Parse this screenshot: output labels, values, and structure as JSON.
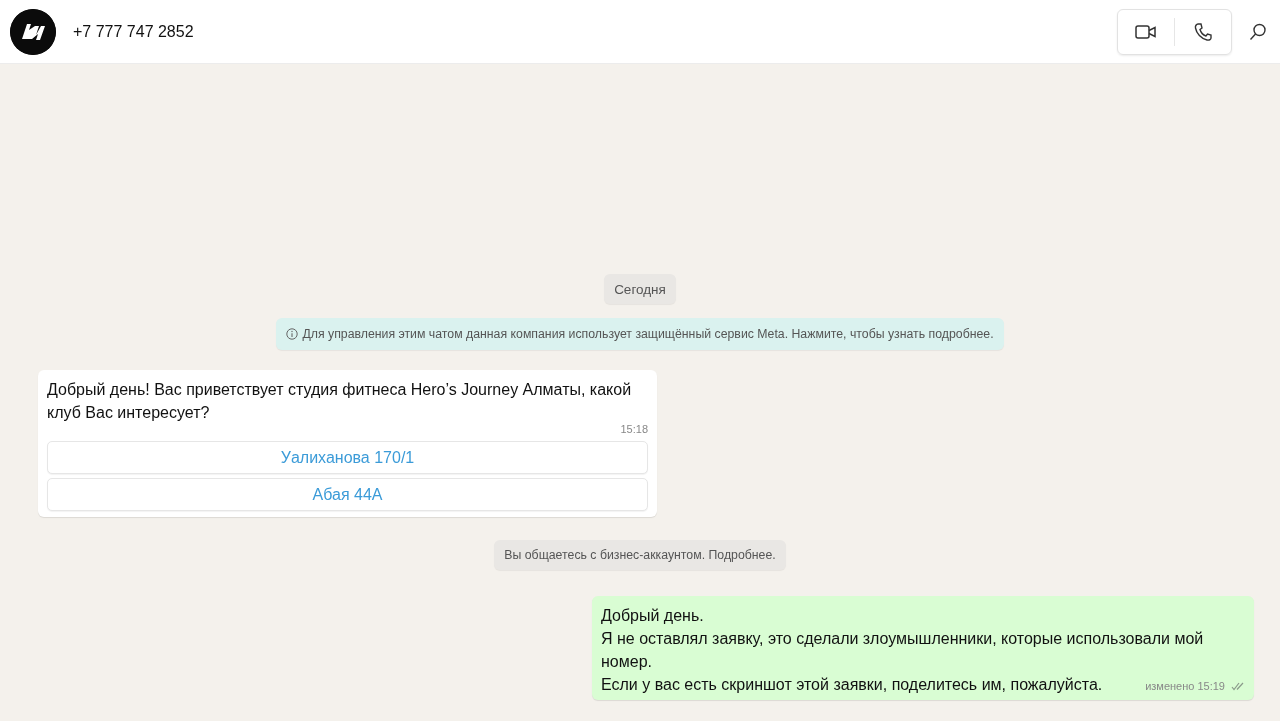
{
  "header": {
    "contact": "+7 777 747 2852"
  },
  "chat": [
    {
      "kind": "date",
      "text": "Сегодня"
    },
    {
      "kind": "notice",
      "text": "Для управления этим чатом данная компания использует защищённый сервис Meta. Нажмите, чтобы узнать подробнее."
    },
    {
      "kind": "incoming",
      "lines": [
        "Добрый день! Вас приветствует студия фитнеса Hero’s Journey Алматы, какой клуб Вас интересует?"
      ],
      "time": "15:18",
      "buttons": [
        "Уалиханова 170/1",
        "Абая 44А"
      ]
    },
    {
      "kind": "system",
      "text": "Вы общаетесь с бизнес-аккаунтом. Подробнее."
    },
    {
      "kind": "outgoing",
      "lines": [
        "Добрый день.",
        "Я не оставлял заявку, это сделали злоумышленники, которые использовали мой номер.",
        "Если у вас есть скриншот этой заявки, поделитесь им, пожалуйста."
      ],
      "time": "изменено 15:19",
      "read": false
    }
  ]
}
